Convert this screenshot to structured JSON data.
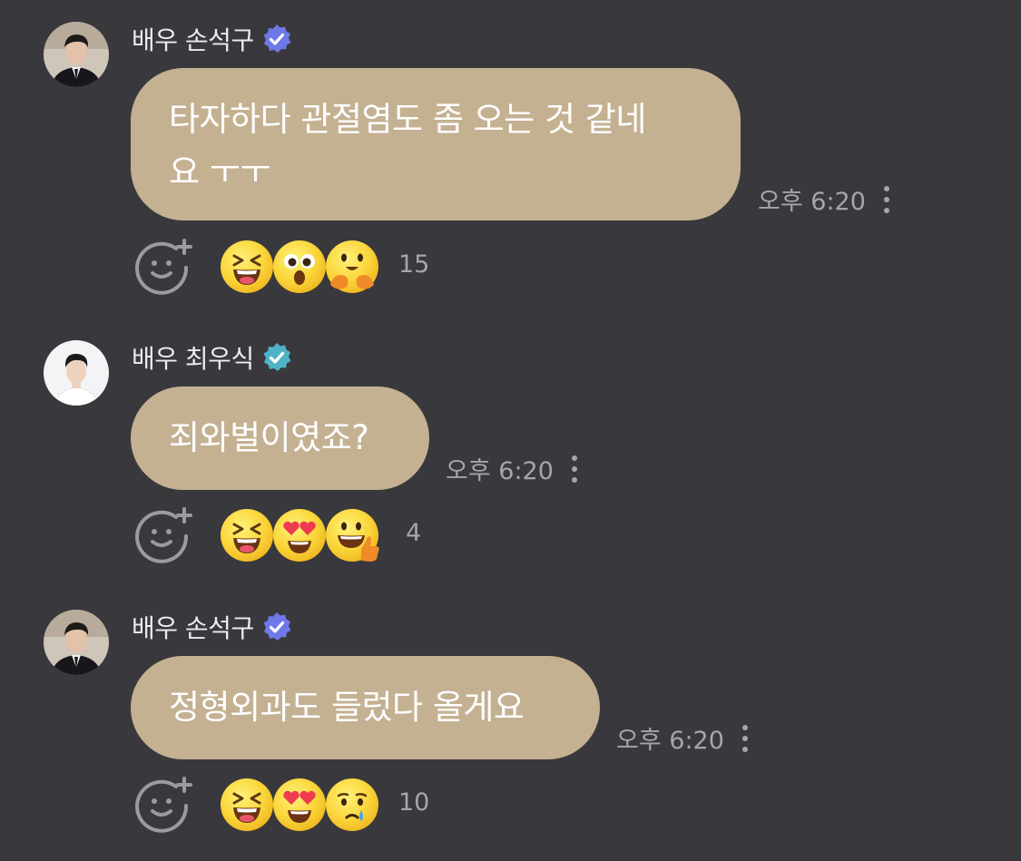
{
  "messages": [
    {
      "author": "배우 손석구",
      "avatar": "avatar-son",
      "badge_color": "#6f78e8",
      "text_lines": [
        "타자하다 관절염도 좀 오는 것 같네",
        "요 ㅜㅜ"
      ],
      "time": "오후 6:20",
      "reactions": [
        "grinning-squint-emoji",
        "surprised-emoji",
        "hugging-emoji"
      ],
      "reaction_count": "15"
    },
    {
      "author": "배우 최우식",
      "avatar": "avatar-choi",
      "badge_color": "#4fb3c8",
      "text_lines": [
        "죄와벌이였죠?"
      ],
      "time": "오후 6:20",
      "reactions": [
        "grinning-squint-emoji",
        "heart-eyes-emoji",
        "thumbs-up-emoji"
      ],
      "reaction_count": "4"
    },
    {
      "author": "배우 손석구",
      "avatar": "avatar-son",
      "badge_color": "#6f78e8",
      "text_lines": [
        "정형외과도 들렀다 올게요"
      ],
      "time": "오후 6:20",
      "reactions": [
        "grinning-squint-emoji",
        "heart-eyes-emoji",
        "crying-emoji"
      ],
      "reaction_count": "10"
    }
  ],
  "colors": {
    "background": "#39383c",
    "bubble": "#c4b192",
    "meta_text": "#a5a5aa",
    "name_text": "#ececee",
    "emoji_yellow": "#f9d43a"
  },
  "icons": {
    "add_reaction": "smile-plus-icon",
    "more": "more-vertical-icon",
    "verified": "verified-badge-icon"
  }
}
